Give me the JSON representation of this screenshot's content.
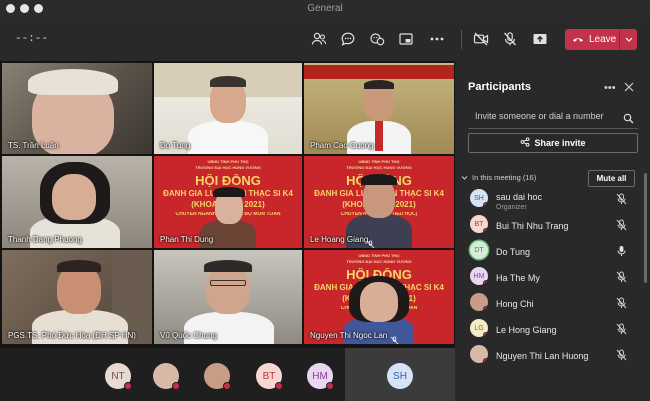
{
  "window": {
    "title": "General"
  },
  "toolbar": {
    "timer": "--:--",
    "leave_label": "Leave",
    "icons": [
      "people-icon",
      "chat-icon",
      "reactions-icon",
      "share-tray-icon",
      "more-icon",
      "camera-off-icon",
      "mic-off-icon",
      "share-screen-icon"
    ]
  },
  "video_tiles": [
    {
      "name": "TS. Trần Luận"
    },
    {
      "name": "Do Tung"
    },
    {
      "name": "Pham Cao Cuong"
    },
    {
      "name": "Thanh Dang Phuong"
    },
    {
      "name": "Phan Thi Dung",
      "banner": [
        "UBND TỈNH PHÚ THỌ",
        "TRƯỜNG ĐẠI HỌC HÙNG VƯƠNG",
        "HỘI ĐỒNG",
        "ĐÁNH GIÁ LUẬN VĂN THẠC SĨ K4",
        "(KHÓA 2019 - 2021)",
        "CHUYÊN NGÀNH: LL&PPDH BỘ MÔN TOÁN"
      ]
    },
    {
      "name": "Le Hoang Giang",
      "banner": [
        "UBND TỈNH PHÚ THỌ",
        "TRƯỜNG ĐẠI HỌC HÙNG VƯƠNG",
        "HỘI ĐỒNG",
        "ĐÁNH GIÁ LUẬN VĂN THẠC SĨ K4",
        "(KHÓA 2019 - 2021)",
        "CHUYÊN NGÀNH: ... (TIỂU HỌC)"
      ]
    },
    {
      "name": "PGS.TS. Phó Đức Hòa (ĐH SP HN)"
    },
    {
      "name": "Vũ Quốc Chung"
    },
    {
      "name": "Nguyen Thi Ngoc Lan",
      "banner": [
        "UBND TỈNH PHÚ THỌ",
        "TRƯỜNG ĐẠI HỌC HÙNG VƯƠNG",
        "HỘI ĐỒNG",
        "ĐÁNH GIÁ LUẬN VĂN THẠC SĨ K4",
        "(KHÓA 2019 - 2021)",
        "CHUYÊN NGÀNH: ... MÔN TOÁN"
      ]
    }
  ],
  "avatar_bar": [
    {
      "initials": "NT",
      "color": "#e8d9d3",
      "text_color": "#7a4e3a"
    },
    {
      "initials": "",
      "color": "#d9b8a8",
      "text_color": "#ffffff"
    },
    {
      "initials": "",
      "color": "#c99c86",
      "text_color": "#ffffff"
    },
    {
      "initials": "BT",
      "color": "#f6d7d1",
      "text_color": "#c4314b"
    },
    {
      "initials": "HM",
      "color": "#e9d6ef",
      "text_color": "#8a3f9e"
    },
    {
      "initials": "SH",
      "color": "#d5e3f4",
      "text_color": "#3566a5"
    }
  ],
  "participants": {
    "title": "Participants",
    "invite_placeholder": "Invite someone or dial a number",
    "share_invite_label": "Share invite",
    "section_label": "In this meeting (16)",
    "mute_all_label": "Mute all",
    "list": [
      {
        "initials": "SH",
        "name": "sau dai hoc",
        "subtitle": "Organizer",
        "avatar_color": "#d5e3f4",
        "initials_color": "#3566a5",
        "mic": "muted"
      },
      {
        "initials": "BT",
        "name": "Bui Thi Nhu Trang",
        "subtitle": "",
        "avatar_color": "#f6d7d1",
        "initials_color": "#c4314b",
        "mic": "muted"
      },
      {
        "initials": "DT",
        "name": "Do Tung",
        "subtitle": "",
        "avatar_color": "#d6ecd9",
        "initials_color": "#3f8a4e",
        "mic": "on"
      },
      {
        "initials": "HM",
        "name": "Ha The My",
        "subtitle": "",
        "avatar_color": "#e9d6ef",
        "initials_color": "#8a3f9e",
        "mic": "muted"
      },
      {
        "initials": "",
        "name": "Hong Chi",
        "subtitle": "",
        "avatar_color": "#c99c86",
        "initials_color": "#ffffff",
        "mic": "muted"
      },
      {
        "initials": "LG",
        "name": "Le Hong Giang",
        "subtitle": "",
        "avatar_color": "#f4ecc7",
        "initials_color": "#8a7425",
        "mic": "muted"
      },
      {
        "initials": "",
        "name": "Nguyen Thi Lan Huong",
        "subtitle": "",
        "avatar_color": "#d9b8a8",
        "initials_color": "#ffffff",
        "mic": "muted"
      }
    ]
  },
  "colors": {
    "leave": "#c4314b",
    "panel": "#292929",
    "toolbar": "#292929",
    "banner_red": "#c8262a"
  }
}
